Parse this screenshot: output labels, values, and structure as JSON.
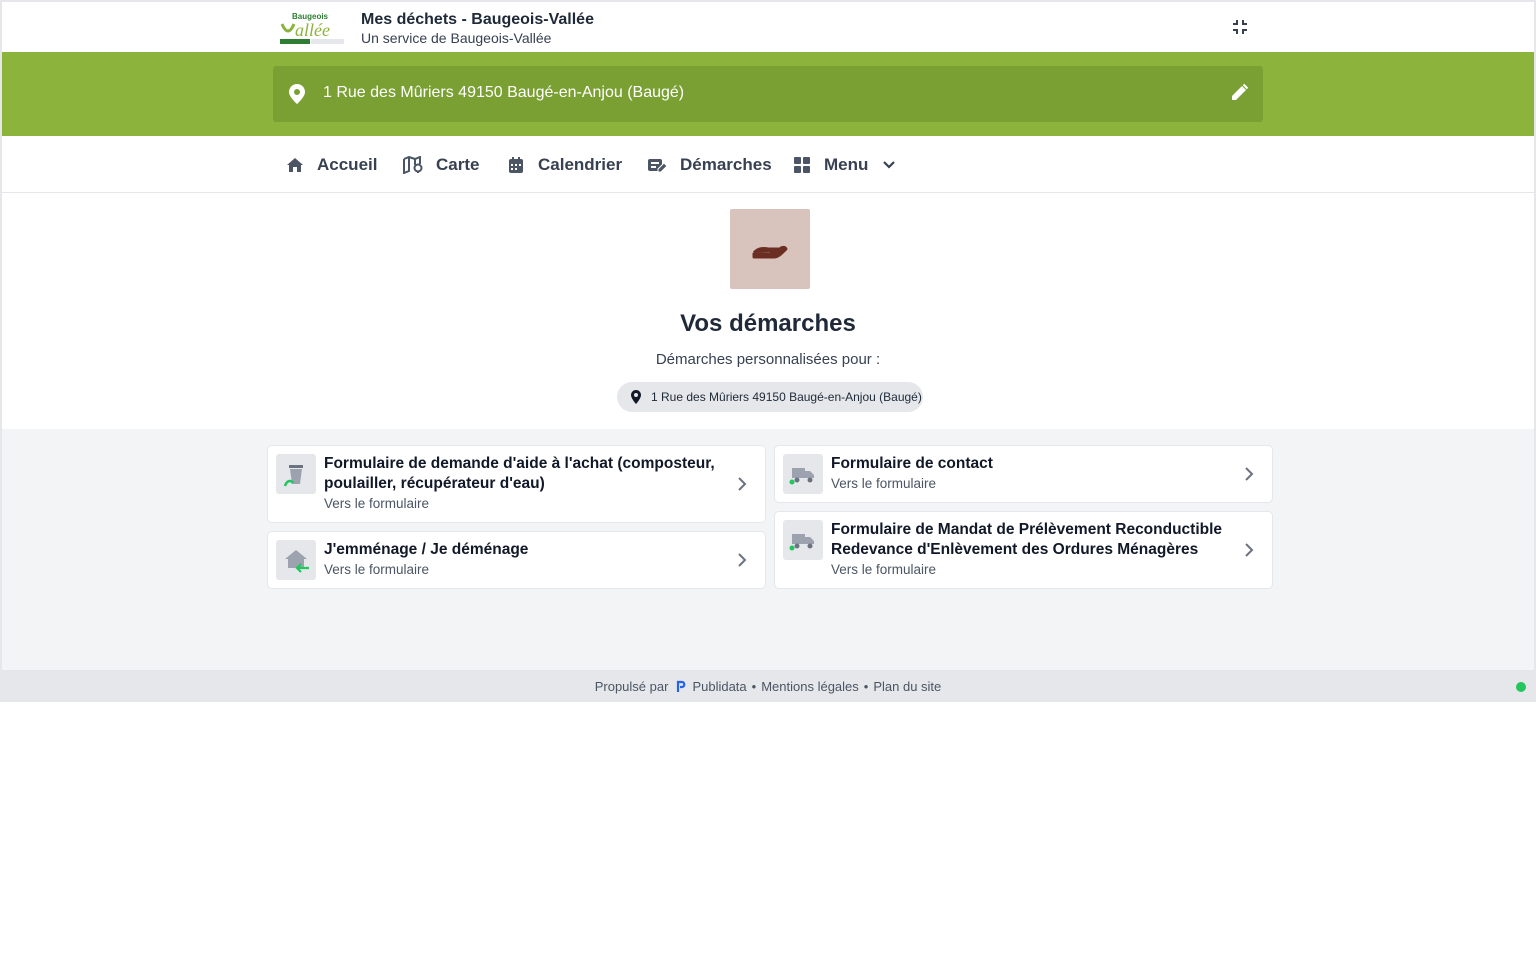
{
  "header": {
    "title": "Mes déchets - Baugeois-Vallée",
    "subtitle": "Un service de Baugeois-Vallée",
    "logo_text": "Baugeois Vallée",
    "collapse_icon": "collapse-icon"
  },
  "address": {
    "value": "1 Rue des Mûriers 49150 Baugé-en-Anjou (Baugé)",
    "pin_icon": "location-pin-icon",
    "edit_icon": "pencil-icon"
  },
  "nav": {
    "items": [
      {
        "label": "Accueil",
        "icon": "home-icon"
      },
      {
        "label": "Carte",
        "icon": "map-icon"
      },
      {
        "label": "Calendrier",
        "icon": "calendar-icon"
      },
      {
        "label": "Démarches",
        "icon": "form-edit-icon"
      },
      {
        "label": "Menu",
        "icon": "grid-icon"
      }
    ]
  },
  "hero": {
    "title": "Vos démarches",
    "subtitle": "Démarches personnalisées pour :",
    "chip": "1 Rue des Mûriers 49150 Baugé-en-Anjou (Baugé)"
  },
  "cards": [
    {
      "title": "Formulaire de demande d'aide à l'achat (composteur, poulailler, récupérateur d'eau)",
      "subtitle": "Vers le formulaire",
      "icon": "bin-icon"
    },
    {
      "title": "Formulaire de contact",
      "subtitle": "Vers le formulaire",
      "icon": "truck-icon"
    },
    {
      "title": "J'emménage / Je déménage",
      "subtitle": "Vers le formulaire",
      "icon": "house-move-icon"
    },
    {
      "title": "Formulaire de Mandat de Prélèvement Reconductible Redevance d'Enlèvement des Ordures Ménagères",
      "subtitle": "Vers le formulaire",
      "icon": "truck-icon"
    }
  ],
  "footer": {
    "powered": "Propulsé par",
    "brand": "Publidata",
    "legal": "Mentions légales",
    "sitemap": "Plan du site"
  },
  "colors": {
    "brand_green": "#8cb43c",
    "address_bar": "#7aa033",
    "hero_icon_bg": "#d8c3bd",
    "status_dot": "#22c55e"
  }
}
